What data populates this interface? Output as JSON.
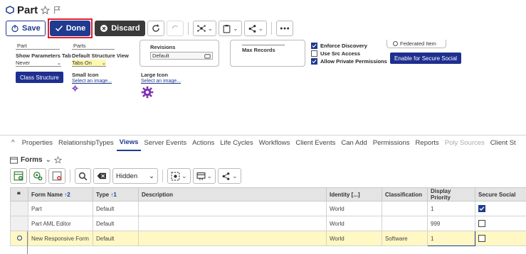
{
  "title": {
    "text": "Part"
  },
  "toolbar": {
    "save": "Save",
    "done": "Done",
    "discard": "Discard"
  },
  "form": {
    "col1_value": "Part",
    "col2_value": "Parts",
    "show_params_label": "Show Parameters Tab",
    "show_params_value": "Never",
    "default_structure_label": "Default Structure View",
    "default_structure_value": "Tabs On",
    "class_structure_button": "Class Structure",
    "small_icon_label": "Small Icon",
    "small_icon_link": "Select an image...",
    "large_icon_label": "Large Icon",
    "large_icon_link": "Select an image...",
    "revisions_label": "Revisions",
    "revisions_value": "Default",
    "max_records_label": "Max Records",
    "enforce_discovery": "Enforce Discovery",
    "use_src_access": "Use Src Access",
    "allow_private": "Allow Private Permissions",
    "federated_item": "Federated Item",
    "enable_secure_social": "Enable for Secure Social"
  },
  "tabs": [
    "Properties",
    "RelationshipTypes",
    "Views",
    "Server Events",
    "Actions",
    "Life Cycles",
    "Workflows",
    "Client Events",
    "Can Add",
    "Permissions",
    "Reports",
    "Poly Sources",
    "Client St"
  ],
  "forms_section": {
    "title": "Forms",
    "view_select": "Hidden"
  },
  "grid": {
    "headers": {
      "form_name": "Form Name",
      "form_name_sort": "↑2",
      "type": "Type",
      "type_sort": "↑1",
      "description": "Description",
      "identity": "Identity [...]",
      "classification": "Classification",
      "display_priority": "Display Priority",
      "secure_social": "Secure Social"
    },
    "rows": [
      {
        "form_name": "Part",
        "type": "Default",
        "description": "",
        "identity": "World",
        "classification": "",
        "display_priority": "1",
        "secure_social": true
      },
      {
        "form_name": "Part AML Editor",
        "type": "Default",
        "description": "",
        "identity": "World",
        "classification": "",
        "display_priority": "999",
        "secure_social": false
      },
      {
        "form_name": "New Responsive Form",
        "type": "Default",
        "description": "",
        "identity": "World",
        "classification": "Software",
        "display_priority": "1",
        "secure_social": false
      }
    ]
  },
  "colors": {
    "primary": "#1f3a8f",
    "discard": "#3a3a3a",
    "highlight": "#e0202a",
    "selected_row": "#fff8c4"
  }
}
